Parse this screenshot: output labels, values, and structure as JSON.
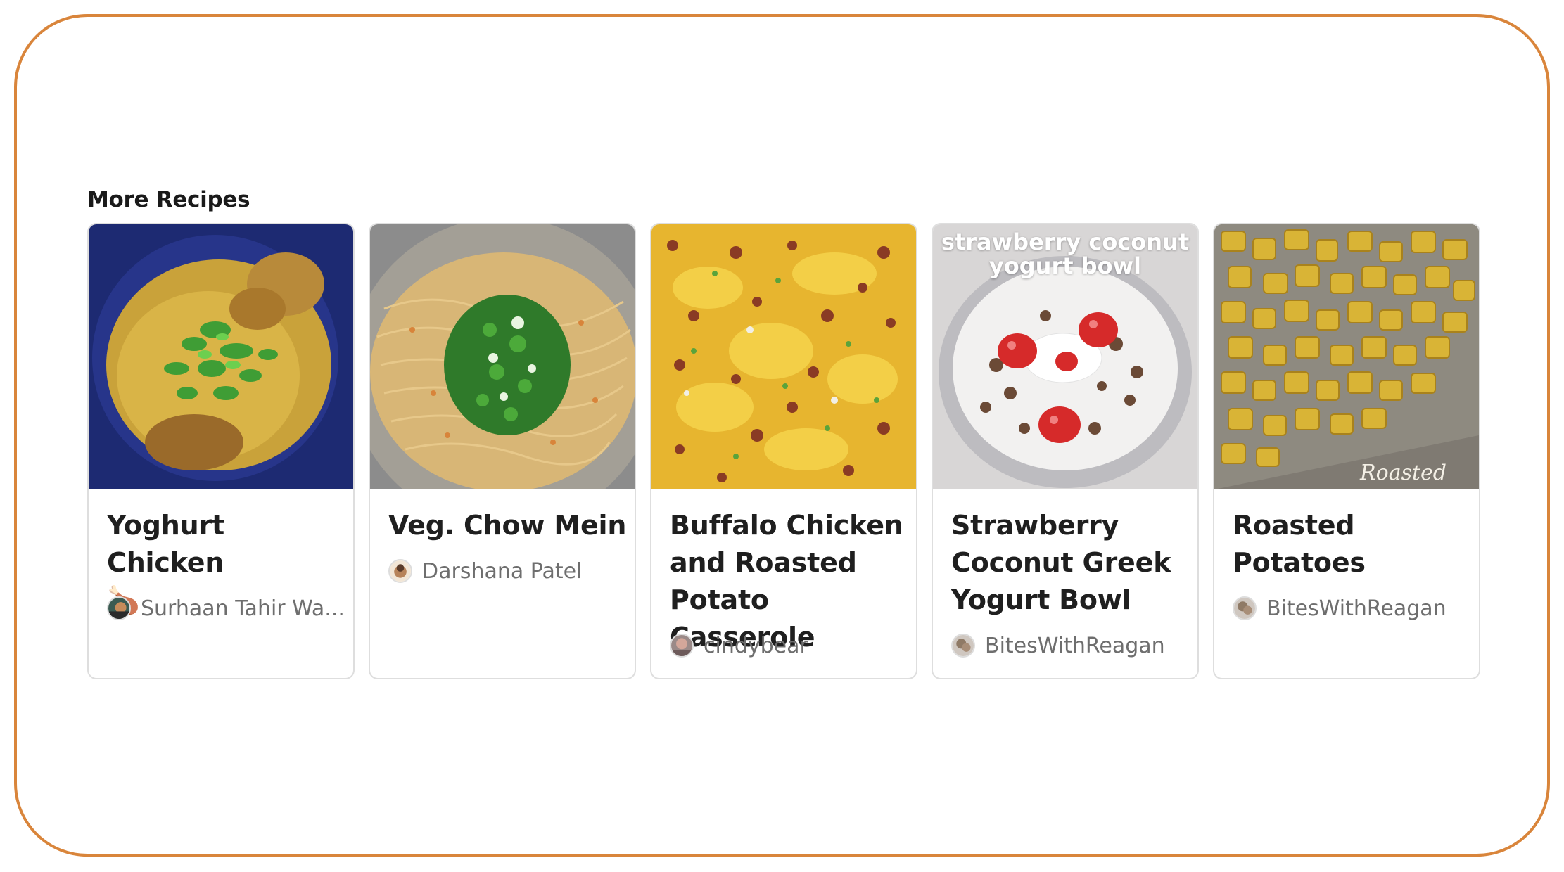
{
  "section": {
    "title": "More Recipes"
  },
  "recipes": [
    {
      "title": "Yoghurt Chicken",
      "emoji": "🍗",
      "author": "Surhaan Tahir Wa...",
      "image": "yoghurt-chicken-photo"
    },
    {
      "title": "Veg. Chow Mein",
      "author": "Darshana Patel",
      "image": "chow-mein-photo"
    },
    {
      "title": "Buffalo Chicken and Roasted Potato Casserole",
      "author": "cindybear",
      "image": "casserole-photo"
    },
    {
      "title": "Strawberry Coconut Greek Yogurt Bowl",
      "author": "BitesWithReagan",
      "image": "yogurt-bowl-photo",
      "overlay": "strawberry coconut yogurt bowl"
    },
    {
      "title": "Roasted Potatoes",
      "author": "BitesWithReagan",
      "image": "roasted-potatoes-photo",
      "overlay": "Roasted"
    }
  ],
  "colors": {
    "frame": "#d9853b",
    "title": "#1f1f1f",
    "author": "#6e6e6e",
    "border": "#dedede"
  }
}
